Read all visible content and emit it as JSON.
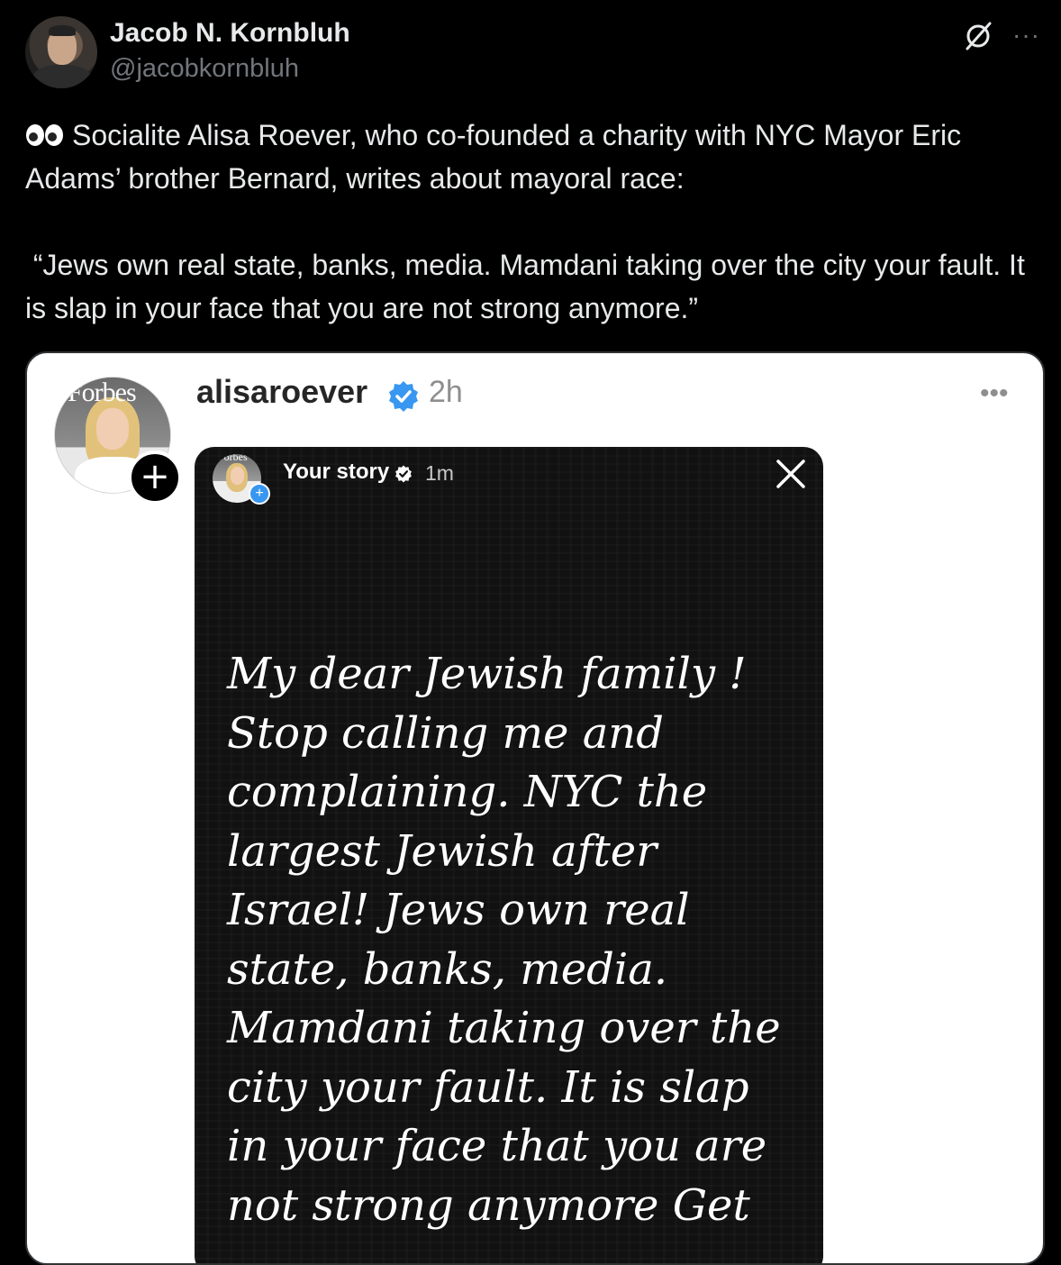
{
  "tweet": {
    "author_name": "Jacob N. Kornbluh",
    "author_handle": "@jacobkornbluh",
    "text": "Socialite Alisa Roever, who co-founded a charity with NYC Mayor Eric Adams’ brother Bernard, writes about mayoral race:\n\n “Jews own real state, banks, media. Mamdani taking over the city your fault. It is slap in your face that you are not strong anymore.”",
    "leading_icon": "eyes-emoji",
    "more_label": "···"
  },
  "instagram_post": {
    "avatar_brand": "Forbes",
    "username": "alisaroever",
    "time": "2h",
    "more_label": "•••",
    "add_label": "+"
  },
  "story": {
    "avatar_brand": "Forbes",
    "label": "Your story",
    "time": "1m",
    "add_label": "+",
    "text": "My dear Jewish family !\nStop calling me and\ncomplaining. NYC the\nlargest Jewish after\nIsrael! Jews own real\nstate, banks, media.\nMamdani taking over the\ncity your fault. It is slap\nin your face that you are\nnot strong anymore Get"
  },
  "colors": {
    "background": "#000000",
    "text_primary": "#e7e9ea",
    "text_secondary": "#71767b",
    "verified_blue": "#3897f0"
  }
}
